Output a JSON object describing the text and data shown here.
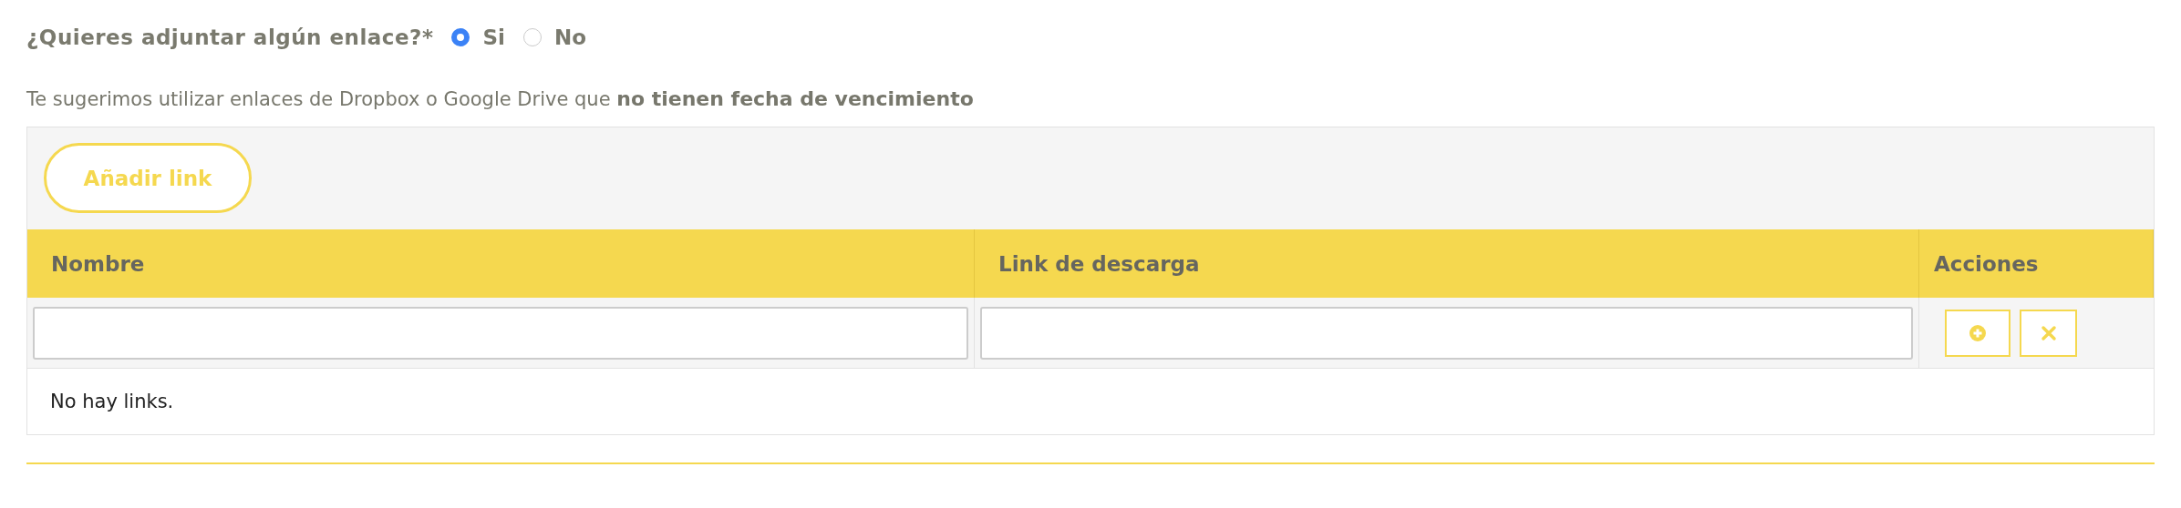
{
  "question": {
    "label": "¿Quieres adjuntar algún enlace?*",
    "options": [
      {
        "label": "Si",
        "selected": true
      },
      {
        "label": "No",
        "selected": false
      }
    ]
  },
  "hint": "Te sugerimos utilizar enlaces de Dropbox o Google Drive que **no tienen fecha de vencimiento**",
  "links_table": {
    "add_button": "Añadir link",
    "columns": [
      "Nombre",
      "Link de descarga",
      "Acciones"
    ],
    "actions": [
      {
        "kind": "add"
      },
      {
        "kind": "remove"
      }
    ],
    "empty_message": "No hay links."
  }
}
